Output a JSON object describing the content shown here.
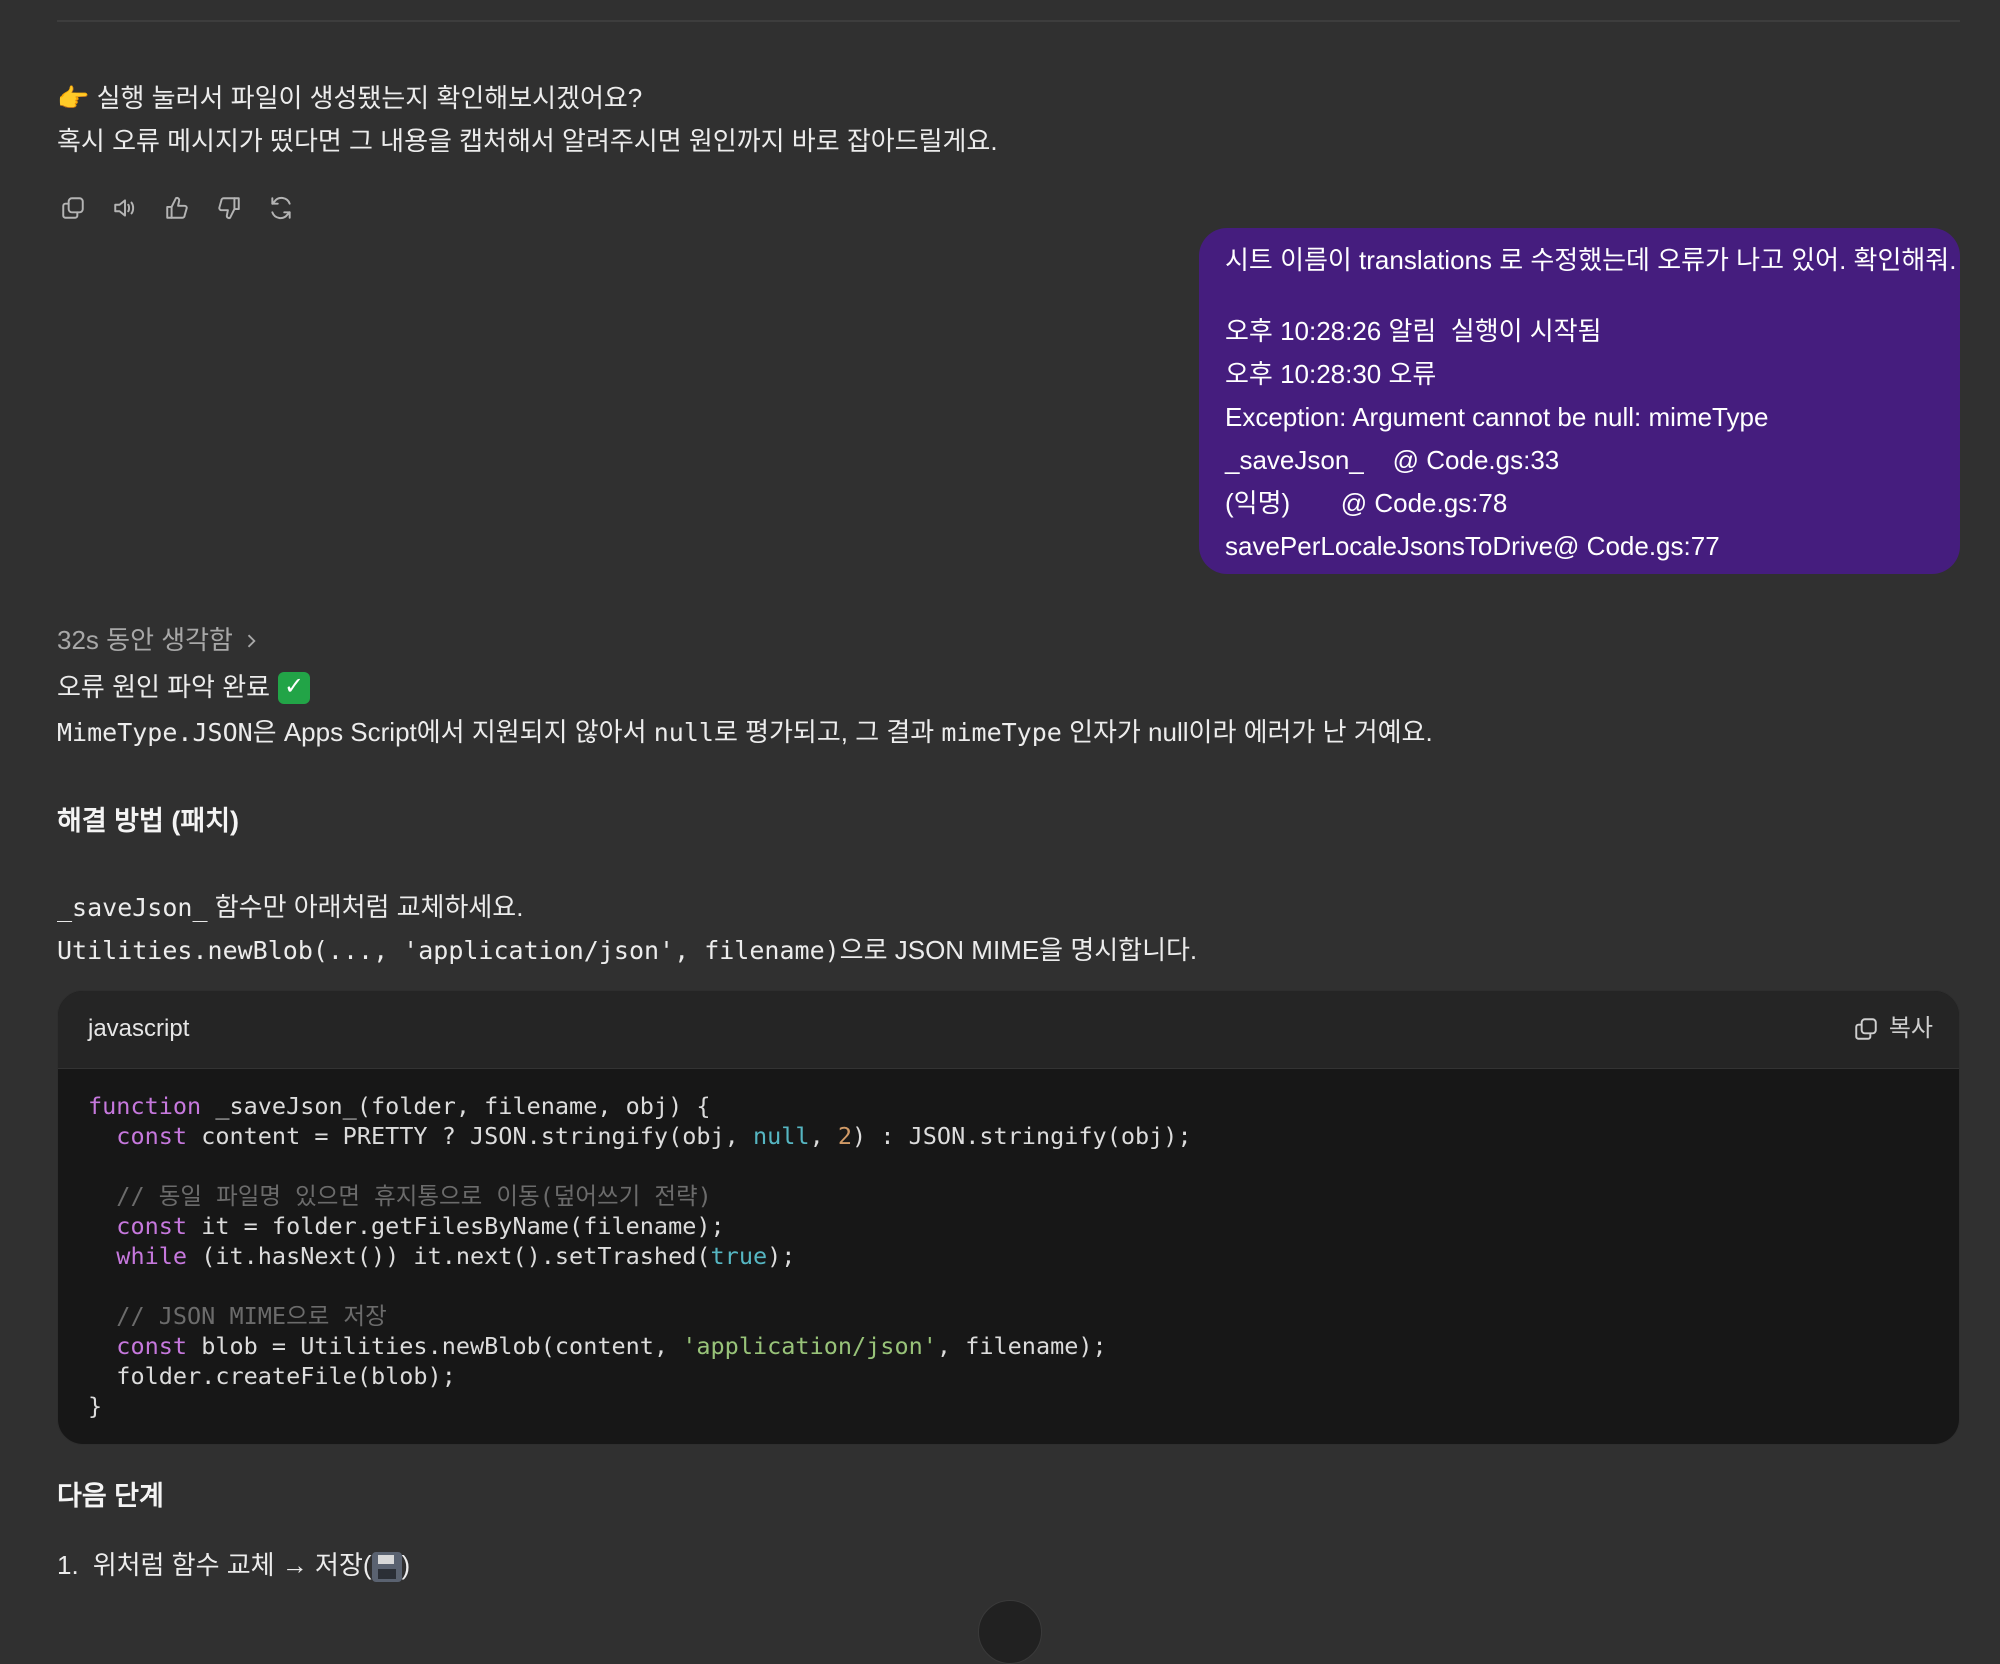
{
  "assistant_msg1": {
    "line1": "👉 실행 눌러서 파일이 생성됐는지 확인해보시겠어요?",
    "line2": "혹시 오류 메시지가 떴다면 그 내용을 캡처해서 알려주시면 원인까지 바로 잡아드릴게요."
  },
  "action_bar": {
    "icons": [
      "copy-icon",
      "read-aloud-icon",
      "thumbs-up-icon",
      "thumbs-down-icon",
      "regenerate-icon"
    ]
  },
  "user_msg": {
    "line1": "시트 이름이 translations 로 수정했는데 오류가 나고 있어. 확인해줘.",
    "line2": "오후 10:28:26 알림  실행이 시작됨",
    "line3": "오후 10:28:30 오류",
    "line4": "Exception: Argument cannot be null: mimeType",
    "line5": "_saveJson_    @ Code.gs:33",
    "line6": "(익명)       @ Code.gs:78",
    "line7": "savePerLocaleJsonsToDrive@ Code.gs:77",
    "bg_color": "#451d7e"
  },
  "thinking": {
    "label": "32s 동안 생각함"
  },
  "summary": {
    "title": "오류 원인 파악 완료",
    "check_emoji": "✓",
    "code1": "MimeType.JSON",
    "text1": "은 Apps Script에서 지원되지 않아서 ",
    "code2": "null",
    "text2": "로 평가되고, 그 결과 ",
    "code3": "mimeType",
    "text3": " 인자가 null이라 에러가 난 거예요."
  },
  "fix_section": {
    "heading": "해결 방법 (패치)",
    "line1_code": "_saveJson_",
    "line1_text": " 함수만 아래처럼 교체하세요.",
    "line2_code": "Utilities.newBlob(..., 'application/json', filename)",
    "line2_text": "으로 JSON MIME을 명시합니다."
  },
  "code_block": {
    "language": "javascript",
    "copy_label": "복사",
    "lines": [
      "function _saveJson_(folder, filename, obj) {",
      "  const content = PRETTY ? JSON.stringify(obj, null, 2) : JSON.stringify(obj);",
      "",
      "  // 동일 파일명 있으면 휴지통으로 이동(덮어쓰기 전략)",
      "  const it = folder.getFilesByName(filename);",
      "  while (it.hasNext()) it.next().setTrashed(true);",
      "",
      "  // JSON MIME으로 저장",
      "  const blob = Utilities.newBlob(content, 'application/json', filename);",
      "  folder.createFile(blob);",
      "}"
    ]
  },
  "next_section": {
    "heading": "다음 단계",
    "items": [
      {
        "number": "1.",
        "text": "위처럼 함수 교체 → 저장(",
        "emoji": "floppy-disk-icon",
        "suffix": ")"
      }
    ]
  }
}
